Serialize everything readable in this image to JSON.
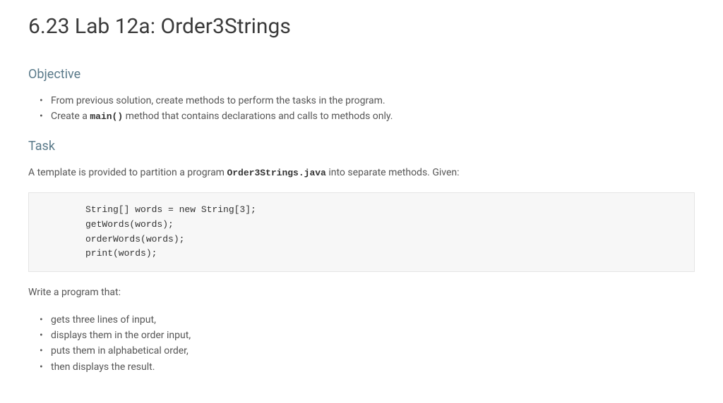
{
  "title": "6.23 Lab 12a: Order3Strings",
  "sections": {
    "objective": {
      "heading": "Objective",
      "items": [
        {
          "prefix": "From previous solution, create methods to perform the tasks in the program.",
          "code": "",
          "suffix": ""
        },
        {
          "prefix": "Create a ",
          "code": "main()",
          "suffix": " method that contains declarations and calls to methods only."
        }
      ]
    },
    "task": {
      "heading": "Task",
      "intro_prefix": "A template is provided to partition a program ",
      "intro_code": "Order3Strings.java",
      "intro_suffix": " into separate methods. Given:",
      "code_block": "String[] words = new String[3];\ngetWords(words);\norderWords(words);\nprint(words);",
      "write_intro": "Write a program that:",
      "items": [
        "gets three lines of input,",
        "displays them in the order input,",
        "puts them in alphabetical order,",
        "then displays the result."
      ]
    }
  }
}
